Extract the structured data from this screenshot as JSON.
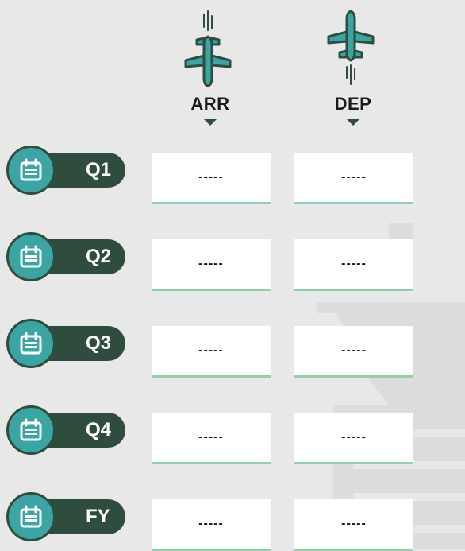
{
  "columns": [
    {
      "label": "ARR",
      "icon": "plane-arrival-icon"
    },
    {
      "label": "DEP",
      "icon": "plane-departure-icon"
    }
  ],
  "rows": [
    {
      "label": "Q1",
      "arr": "-----",
      "dep": "-----"
    },
    {
      "label": "Q2",
      "arr": "-----",
      "dep": "-----"
    },
    {
      "label": "Q3",
      "arr": "-----",
      "dep": "-----"
    },
    {
      "label": "Q4",
      "arr": "-----",
      "dep": "-----"
    },
    {
      "label": "FY",
      "arr": "-----",
      "dep": "-----"
    }
  ],
  "colors": {
    "background": "#e8e8e8",
    "dark_green": "#2e4d3f",
    "teal": "#3aa5a3",
    "cell_underline": "#8fd1a8"
  },
  "row_icon": "calendar-icon"
}
